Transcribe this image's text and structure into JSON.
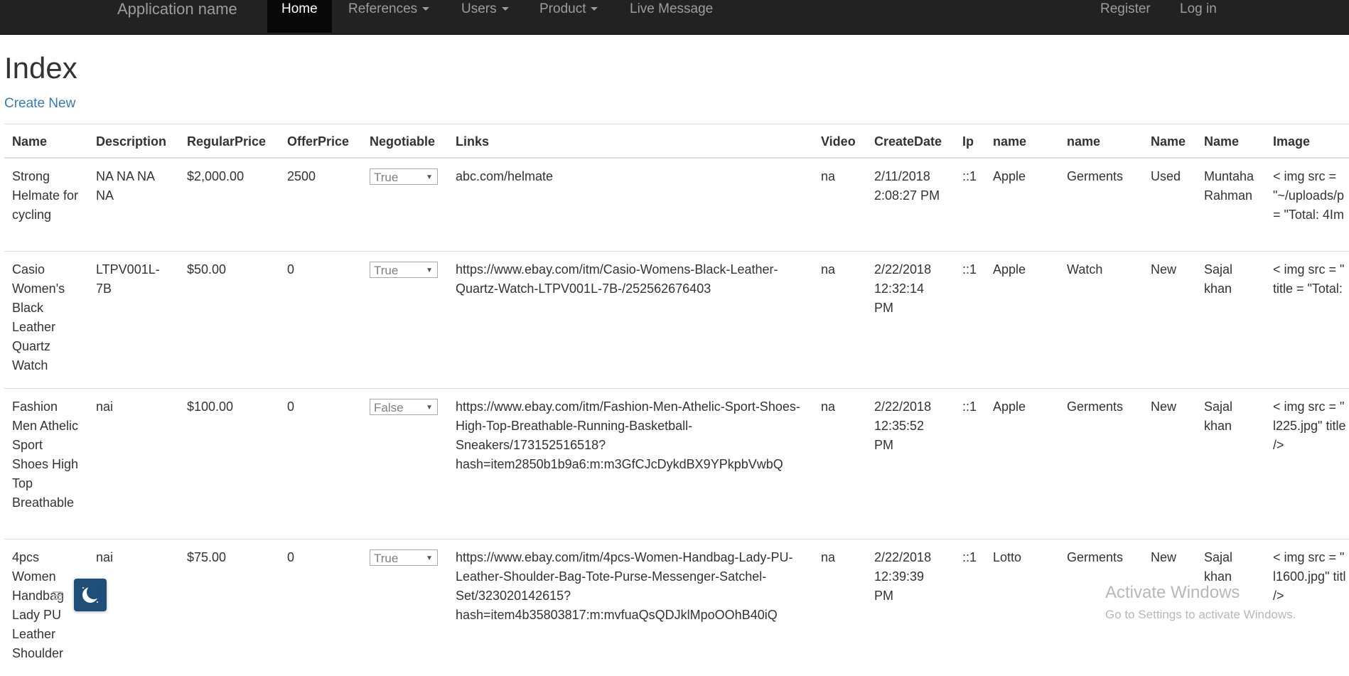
{
  "navbar": {
    "brand": "Application name",
    "items": [
      {
        "label": "Home",
        "dropdown": false
      },
      {
        "label": "References",
        "dropdown": true
      },
      {
        "label": "Users",
        "dropdown": true
      },
      {
        "label": "Product",
        "dropdown": true
      },
      {
        "label": "Live Message",
        "dropdown": false
      }
    ],
    "right": [
      {
        "label": "Register"
      },
      {
        "label": "Log in"
      }
    ]
  },
  "page": {
    "title": "Index",
    "create_new": "Create New"
  },
  "table": {
    "columns": [
      "Name",
      "Description",
      "RegularPrice",
      "OfferPrice",
      "Negotiable",
      "Links",
      "Video",
      "CreateDate",
      "Ip",
      "name",
      "name",
      "Name",
      "Name",
      "Image"
    ],
    "rows": [
      {
        "name": "Strong Helmate for cycling",
        "description": "NA NA NA NA",
        "regular_price": "$2,000.00",
        "offer_price": "2500",
        "negotiable": "True",
        "link": "abc.com/helmate",
        "video": "na",
        "create_date": "2/11/2018 2:08:27 PM",
        "ip": "::1",
        "brand": "Apple",
        "category": "Germents",
        "condition": "Used",
        "user": "Muntaha Rahman",
        "image": [
          "< img src =",
          "\"~/uploads/p",
          "= \"Total: 4Im"
        ]
      },
      {
        "name": "Casio Women's Black Leather Quartz Watch",
        "description": "LTPV001L-7B",
        "regular_price": "$50.00",
        "offer_price": "0",
        "negotiable": "True",
        "link": "https://www.ebay.com/itm/Casio-Womens-Black-Leather-Quartz-Watch-LTPV001L-7B-/252562676403",
        "video": "na",
        "create_date": "2/22/2018 12:32:14 PM",
        "ip": "::1",
        "brand": "Apple",
        "category": "Watch",
        "condition": "New",
        "user": "Sajal khan",
        "image": [
          "< img src = \"",
          "title = \"Total:"
        ]
      },
      {
        "name": "Fashion Men Athelic Sport Shoes High Top Breathable",
        "description": "nai",
        "regular_price": "$100.00",
        "offer_price": "0",
        "negotiable": "False",
        "link": "https://www.ebay.com/itm/Fashion-Men-Athelic-Sport-Shoes-High-Top-Breathable-Running-Basketball-Sneakers/173152516518?hash=item2850b1b9a6:m:m3GfCJcDykdBX9YPkpbVwbQ",
        "video": "na",
        "create_date": "2/22/2018 12:35:52 PM",
        "ip": "::1",
        "brand": "Apple",
        "category": "Germents",
        "condition": "New",
        "user": "Sajal khan",
        "image": [
          "< img src = \"",
          "l225.jpg\" title",
          "/>"
        ]
      },
      {
        "name": "4pcs Women Handbag Lady PU Leather Shoulder",
        "description": "nai",
        "regular_price": "$75.00",
        "offer_price": "0",
        "negotiable": "True",
        "link": "https://www.ebay.com/itm/4pcs-Women-Handbag-Lady-PU-Leather-Shoulder-Bag-Tote-Purse-Messenger-Satchel-Set/323020142615?hash=item4b35803817:m:mvfuaQsQDJklMpoOOhB40iQ",
        "video": "na",
        "create_date": "2/22/2018 12:39:39 PM",
        "ip": "::1",
        "brand": "Lotto",
        "category": "Germents",
        "condition": "New",
        "user": "Sajal khan",
        "image": [
          "< img src = \"",
          "l1600.jpg\" titl",
          "/>"
        ]
      }
    ]
  },
  "overlay": {
    "menu_icon": "hamburger-icon",
    "moon_icon": "moon-icon",
    "activate_title": "Activate Windows",
    "activate_sub": "Go to Settings to activate Windows."
  },
  "colors": {
    "navbar_bg": "#222222",
    "link": "#337ab7",
    "active_nav_bg": "#080808"
  }
}
